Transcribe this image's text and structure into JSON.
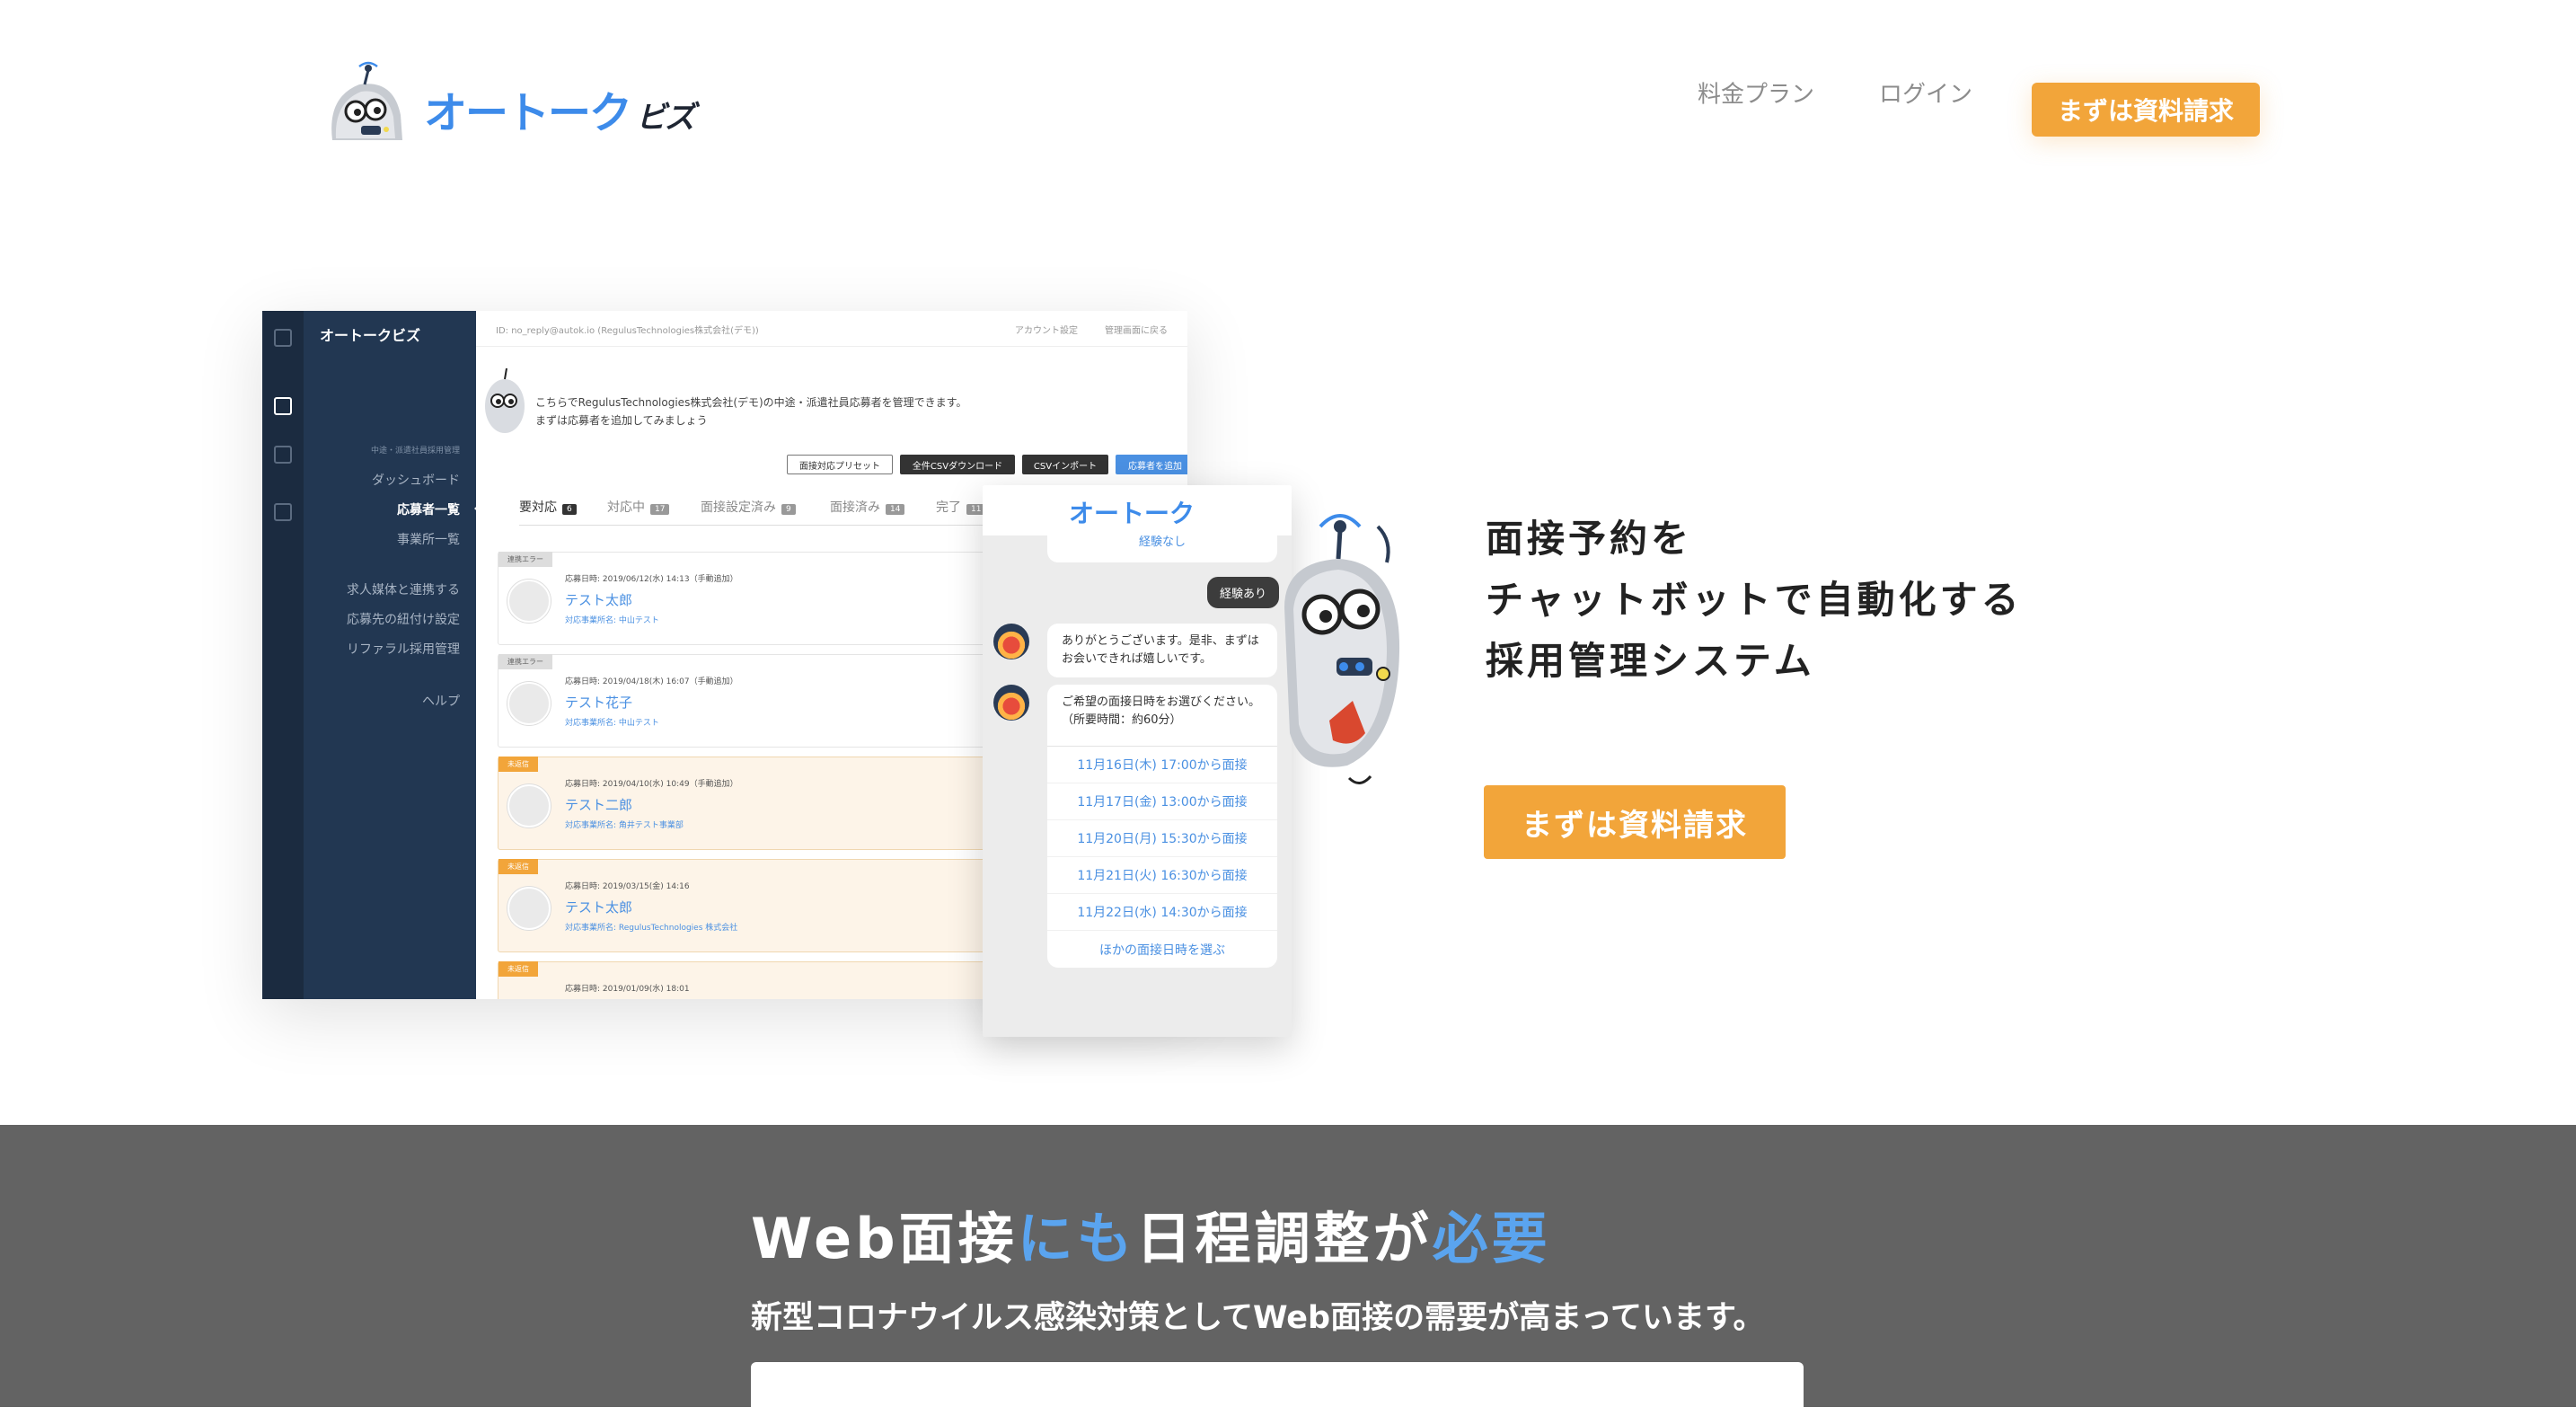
{
  "header": {
    "logo_text": "オートーク",
    "logo_suffix": "ビズ",
    "nav": {
      "pricing": "料金プラン",
      "login": "ログイン"
    },
    "cta": "まずは資料請求"
  },
  "mockup": {
    "brand": "オートークビズ",
    "topbar": {
      "account_id": "ID: no_reply@autok.io (RegulusTechnologies株式会社(デモ))",
      "account_settings": "アカウント設定",
      "admin_back": "管理画面に戻る"
    },
    "side_section": "中途・派遣社員採用管理",
    "side_items": [
      "ダッシュボード",
      "応募者一覧",
      "事業所一覧",
      "求人媒体と連携する",
      "応募先の紐付け設定",
      "リファラル採用管理",
      "ヘルプ"
    ],
    "intro_lines": [
      "こちらでRegulusTechnologies株式会社(デモ)の中途・派遣社員応募者を管理できます。",
      "まずは応募者を追加してみましょう"
    ],
    "buttons": [
      "面接対応プリセット",
      "全件CSVダウンロード",
      "CSVインポート",
      "応募者を追加"
    ],
    "tabs": [
      {
        "label": "要対応",
        "count": "6"
      },
      {
        "label": "対応中",
        "count": "17"
      },
      {
        "label": "面接設定済み",
        "count": "9"
      },
      {
        "label": "面接済み",
        "count": "14"
      },
      {
        "label": "完了",
        "count": "11"
      }
    ],
    "applicants": [
      {
        "tag": "連携エラー",
        "date": "応募日時: 2019/06/12(水) 14:13（手動追加）",
        "name": "テスト太郎",
        "office": "対応事業所名: 中山テスト"
      },
      {
        "tag": "連携エラー",
        "date": "応募日時: 2019/04/18(木) 16:07（手動追加）",
        "name": "テスト花子",
        "office": "対応事業所名: 中山テスト"
      },
      {
        "tag": "未返信",
        "date": "応募日時: 2019/04/10(水) 10:49（手動追加）",
        "name": "テスト二郎",
        "office": "対応事業所名: 角井テスト事業部"
      },
      {
        "tag": "未返信",
        "date": "応募日時: 2019/03/15(金) 14:16",
        "name": "テスト太郎",
        "office": "対応事業所名: RegulusTechnologies 株式会社"
      },
      {
        "tag": "未返信",
        "date": "応募日時: 2019/01/09(水) 18:01",
        "name": "",
        "office": ""
      }
    ]
  },
  "chat": {
    "logo": "オートーク",
    "option_none": "経験なし",
    "user_reply": "経験あり",
    "bot_msg_1": "ありがとうございます。是非、まずはお会いできれば嬉しいです。",
    "bot_msg_2": "ご希望の面接日時をお選びください。（所要時間：約60分）",
    "slots": [
      "11月16日(木) 17:00から面接",
      "11月17日(金) 13:00から面接",
      "11月20日(月) 15:30から面接",
      "11月21日(火) 16:30から面接",
      "11月22日(水) 14:30から面接",
      "ほかの面接日時を選ぶ"
    ]
  },
  "hero": {
    "lines": [
      "面接予約を",
      "チャットボットで自動化する",
      "採用管理システム"
    ],
    "cta": "まずは資料請求"
  },
  "band": {
    "title_parts": [
      "Web面接",
      "にも",
      "日程調整",
      "が",
      "必要"
    ],
    "subtitle": "新型コロナウイルス感染対策としてWeb面接の需要が高まっています。"
  },
  "colors": {
    "accent": "#f2a53a",
    "brand_blue": "#3d8bea",
    "band_bg": "#636363",
    "sidebar": "#223752"
  }
}
